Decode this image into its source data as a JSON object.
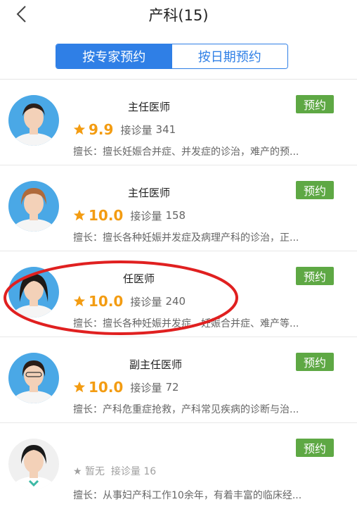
{
  "header": {
    "title": "产科(15)",
    "back_icon": "chevron-left-icon"
  },
  "tabs": [
    {
      "label": "按专家预约",
      "active": true
    },
    {
      "label": "按日期预约",
      "active": false
    }
  ],
  "doctors": [
    {
      "title": "主任医师",
      "score": "9.9",
      "visits_label": "接诊量",
      "visits": "341",
      "specialty": "擅长：擅长妊娠合并症、并发症的诊治，难产的预...",
      "book_label": "预约"
    },
    {
      "title": "主任医师",
      "score": "10.0",
      "visits_label": "接诊量",
      "visits": "158",
      "specialty": "擅长：擅长各种妊娠并发症及病理产科的诊治，正...",
      "book_label": "预约"
    },
    {
      "title": "任医师",
      "score": "10.0",
      "visits_label": "接诊量",
      "visits": "240",
      "specialty": "擅长：擅长各种妊娠并发症、妊娠合并症、难产等...",
      "book_label": "预约"
    },
    {
      "title": "副主任医师",
      "score": "10.0",
      "visits_label": "接诊量",
      "visits": "72",
      "specialty": "擅长：产科危重症抢救，产科常见疾病的诊断与治...",
      "book_label": "预约"
    },
    {
      "title": "",
      "score": "暂无",
      "visits_label": "接诊量",
      "visits": "16",
      "specialty": "擅长：从事妇产科工作10余年，有着丰富的临床经...",
      "book_label": "预约"
    }
  ],
  "colors": {
    "accent": "#2f7fe6",
    "book": "#5ea844",
    "score": "#f39c12",
    "highlight": "#e02020"
  }
}
